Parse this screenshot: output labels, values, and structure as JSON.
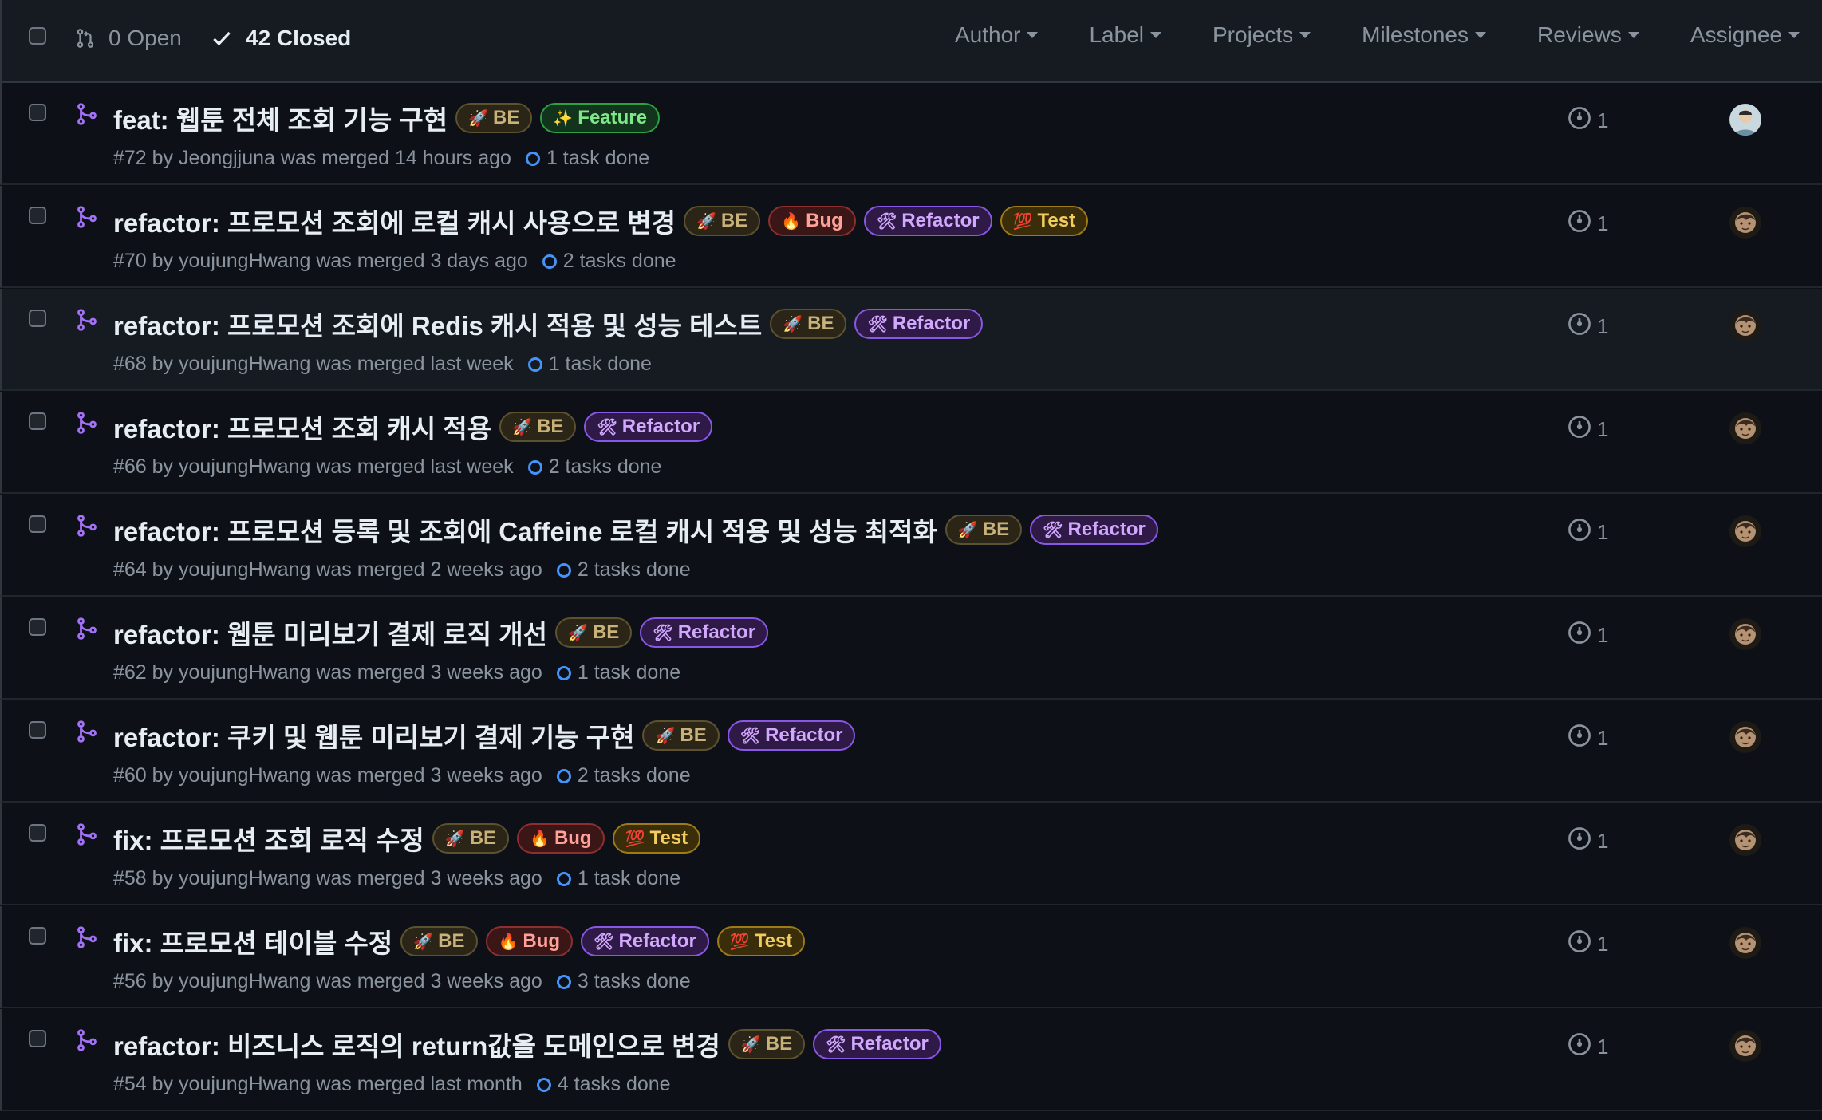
{
  "header": {
    "open_count": "0 Open",
    "closed_count": "42 Closed",
    "filters": [
      "Author",
      "Label",
      "Projects",
      "Milestones",
      "Reviews",
      "Assignee"
    ]
  },
  "label_styles": {
    "BE": {
      "emoji": "🚀",
      "color": "#c9b27a",
      "bg": "#2a2517",
      "border": "#5c5230"
    },
    "Feature": {
      "emoji": "✨",
      "color": "#7ee787",
      "bg": "#12331c",
      "border": "#2ea043"
    },
    "Bug": {
      "emoji": "🔥",
      "color": "#ffa198",
      "bg": "#3b1617",
      "border": "#8e2e2e"
    },
    "Refactor": {
      "emoji": "🛠",
      "color": "#d2a8ff",
      "bg": "#2f1a47",
      "border": "#8957e5"
    },
    "Test": {
      "emoji": "💯",
      "color": "#f2cc60",
      "bg": "#3a2d0a",
      "border": "#9e7b17"
    }
  },
  "pulls": [
    {
      "title": "feat: 웹툰 전체 조회 기능 구현",
      "labels": [
        "BE",
        "Feature"
      ],
      "meta": "#72 by Jeongjjuna was merged 14 hours ago",
      "tasks": "1 task done",
      "comments": "1",
      "avatar": "a"
    },
    {
      "title": "refactor: 프로모션 조회에 로컬 캐시 사용으로 변경",
      "labels": [
        "BE",
        "Bug",
        "Refactor",
        "Test"
      ],
      "meta": "#70 by youjungHwang was merged 3 days ago",
      "tasks": "2 tasks done",
      "comments": "1",
      "avatar": "b"
    },
    {
      "title": "refactor: 프로모션 조회에 Redis 캐시 적용 및 성능 테스트",
      "labels": [
        "BE",
        "Refactor"
      ],
      "meta": "#68 by youjungHwang was merged last week",
      "tasks": "1 task done",
      "comments": "1",
      "avatar": "b",
      "highlight": true
    },
    {
      "title": "refactor: 프로모션 조회 캐시 적용",
      "labels": [
        "BE",
        "Refactor"
      ],
      "meta": "#66 by youjungHwang was merged last week",
      "tasks": "2 tasks done",
      "comments": "1",
      "avatar": "b"
    },
    {
      "title": "refactor: 프로모션 등록 및 조회에 Caffeine 로컬 캐시 적용 및 성능 최적화",
      "labels": [
        "BE",
        "Refactor"
      ],
      "meta": "#64 by youjungHwang was merged 2 weeks ago",
      "tasks": "2 tasks done",
      "comments": "1",
      "avatar": "b"
    },
    {
      "title": "refactor: 웹툰 미리보기 결제 로직 개선",
      "labels": [
        "BE",
        "Refactor"
      ],
      "meta": "#62 by youjungHwang was merged 3 weeks ago",
      "tasks": "1 task done",
      "comments": "1",
      "avatar": "b"
    },
    {
      "title": "refactor: 쿠키 및 웹툰 미리보기 결제 기능 구현",
      "labels": [
        "BE",
        "Refactor"
      ],
      "meta": "#60 by youjungHwang was merged 3 weeks ago",
      "tasks": "2 tasks done",
      "comments": "1",
      "avatar": "b"
    },
    {
      "title": "fix: 프로모션 조회 로직 수정",
      "labels": [
        "BE",
        "Bug",
        "Test"
      ],
      "meta": "#58 by youjungHwang was merged 3 weeks ago",
      "tasks": "1 task done",
      "comments": "1",
      "avatar": "b"
    },
    {
      "title": "fix: 프로모션 테이블 수정",
      "labels": [
        "BE",
        "Bug",
        "Refactor",
        "Test"
      ],
      "meta": "#56 by youjungHwang was merged 3 weeks ago",
      "tasks": "3 tasks done",
      "comments": "1",
      "avatar": "b"
    },
    {
      "title": "refactor: 비즈니스 로직의 return값을 도메인으로 변경",
      "labels": [
        "BE",
        "Refactor"
      ],
      "meta": "#54 by youjungHwang was merged last month",
      "tasks": "4 tasks done",
      "comments": "1",
      "avatar": "b"
    }
  ]
}
